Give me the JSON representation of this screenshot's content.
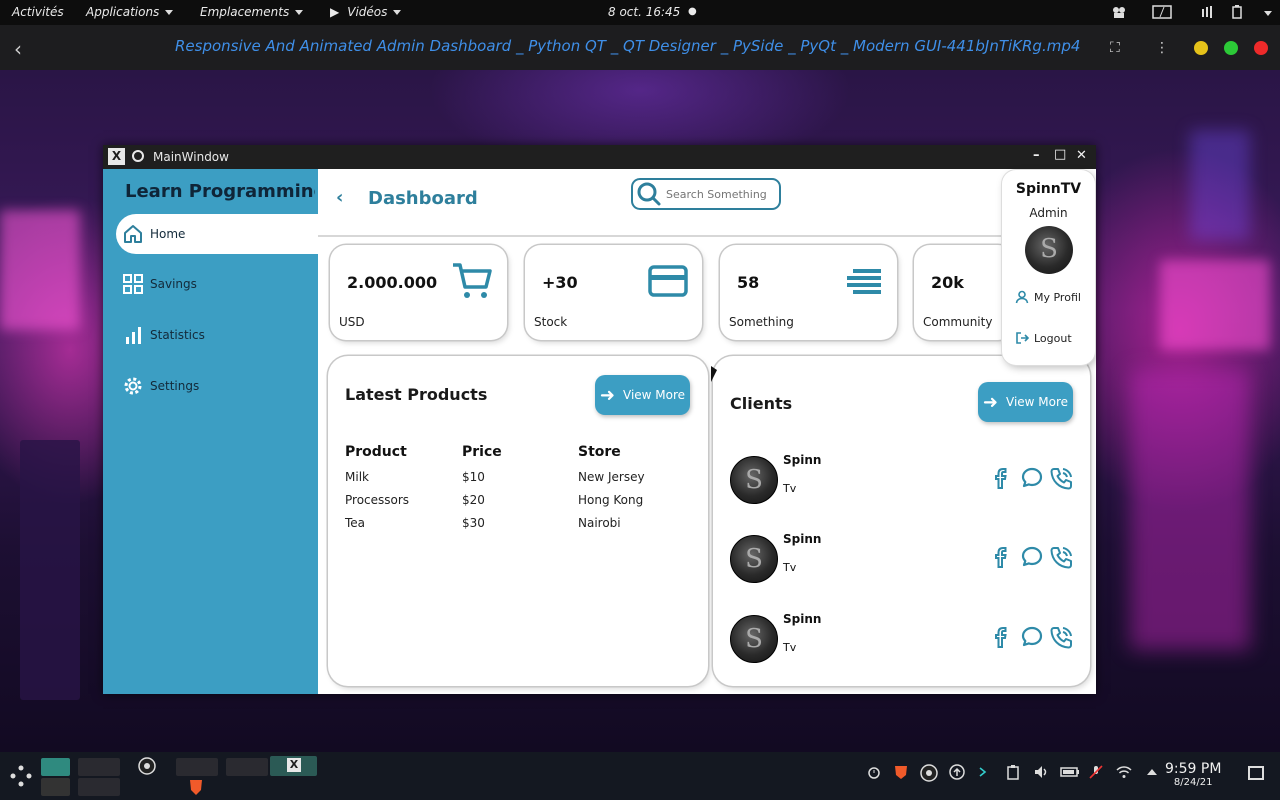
{
  "topbar": {
    "activities": "Activités",
    "applications": "Applications",
    "places": "Emplacements",
    "videos": "Vidéos",
    "datetime": "8 oct.  16:45"
  },
  "player": {
    "title": "Responsive And Animated Admin Dashboard _ Python QT _ QT Designer _ PySide _ PyQt _ Modern GUI-441bJnTiKRg.mp4"
  },
  "window": {
    "title": "MainWindow"
  },
  "sidebar": {
    "brand": "Learn Programming",
    "items": [
      {
        "label": "Home",
        "icon": "home-icon"
      },
      {
        "label": "Savings",
        "icon": "grid-icon"
      },
      {
        "label": "Statistics",
        "icon": "bar-chart-icon"
      },
      {
        "label": "Settings",
        "icon": "gear-icon"
      }
    ]
  },
  "header": {
    "title": "Dashboard",
    "search_placeholder": "Search Something"
  },
  "cards": [
    {
      "value": "2.000.000",
      "label": "USD",
      "icon": "cart-icon"
    },
    {
      "value": "+30",
      "label": "Stock",
      "icon": "credit-card-icon"
    },
    {
      "value": "58",
      "label": "Something",
      "icon": "lines-icon"
    },
    {
      "value": "20k",
      "label": "Community",
      "icon": ""
    }
  ],
  "products": {
    "title": "Latest Products",
    "view_more": "View More",
    "columns": [
      "Product",
      "Price",
      "Store"
    ],
    "rows": [
      [
        "Milk",
        "$10",
        "New Jersey"
      ],
      [
        "Processors",
        "$20",
        "Hong Kong"
      ],
      [
        "Tea",
        "$30",
        "Nairobi"
      ]
    ]
  },
  "clients": {
    "title": "Clients",
    "view_more": "View More",
    "list": [
      {
        "name": "Spinn",
        "sub": "Tv"
      },
      {
        "name": "Spinn",
        "sub": "Tv"
      },
      {
        "name": "Spinn",
        "sub": "Tv"
      }
    ]
  },
  "profile": {
    "name": "SpinnTV",
    "role": "Admin",
    "my_profile": "My Profil",
    "logout": "Logout"
  },
  "taskbar": {
    "time": "9:59 PM",
    "date": "8/24/21"
  },
  "colors": {
    "accent": "#3c9ec3",
    "accent_dark": "#2e7f9c",
    "player_title": "#3f8fe8"
  }
}
